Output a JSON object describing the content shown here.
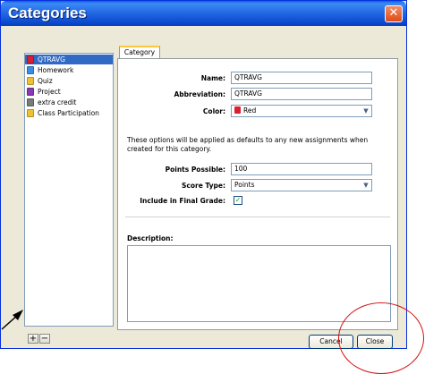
{
  "window": {
    "title": "Categories"
  },
  "categories": [
    {
      "label": "QTRAVG",
      "icon": "red-category-icon",
      "color": "#d92030"
    },
    {
      "label": "Homework",
      "icon": "blue-category-icon",
      "color": "#3a8de0"
    },
    {
      "label": "Quiz",
      "icon": "yellow-category-icon",
      "color": "#f0c030"
    },
    {
      "label": "Project",
      "icon": "purple-category-icon",
      "color": "#8a3ab0"
    },
    {
      "label": "extra credit",
      "icon": "gray-category-icon",
      "color": "#7a7a7a"
    },
    {
      "label": "Class Participation",
      "icon": "yellow-category-icon",
      "color": "#f0c030"
    }
  ],
  "list_buttons": {
    "add": "+",
    "remove": "−"
  },
  "tab": {
    "label": "Category"
  },
  "form": {
    "name_label": "Name:",
    "name_value": "QTRAVG",
    "abbr_label": "Abbreviation:",
    "abbr_value": "QTRAVG",
    "color_label": "Color:",
    "color_value": "Red",
    "hint": "These options will be applied as defaults to any new assignments when created for this category.",
    "points_label": "Points Possible:",
    "points_value": "100",
    "score_type_label": "Score Type:",
    "score_type_value": "Points",
    "include_label": "Include in Final Grade:",
    "include_checked": true,
    "description_label": "Description:",
    "description_value": ""
  },
  "buttons": {
    "cancel": "Cancel",
    "close": "Close"
  },
  "colors": {
    "title_bar": "#1e62e0",
    "selection": "#316ac5",
    "annotation": "#d41010"
  }
}
